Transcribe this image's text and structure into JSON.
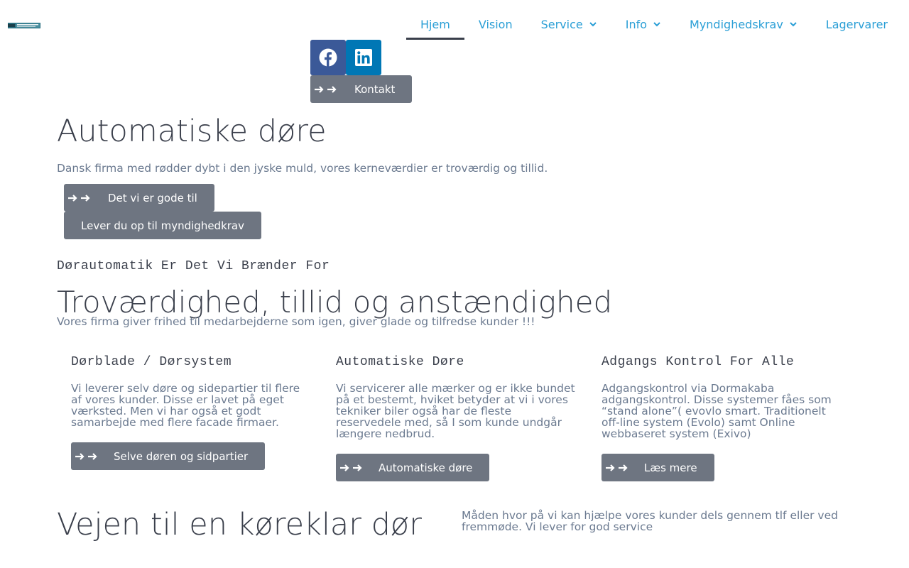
{
  "header": {
    "logo_alt": "TIC SERVICE",
    "nav": [
      {
        "label": "Hjem",
        "active": true,
        "dropdown": false
      },
      {
        "label": "Vision",
        "active": false,
        "dropdown": false
      },
      {
        "label": "Service",
        "active": false,
        "dropdown": true
      },
      {
        "label": "Info",
        "active": false,
        "dropdown": true
      },
      {
        "label": "Myndighedskrav",
        "active": false,
        "dropdown": true
      },
      {
        "label": "Lagervarer",
        "active": false,
        "dropdown": false
      }
    ]
  },
  "social": {
    "facebook_icon": "facebook-icon",
    "linkedin_icon": "linkedin-icon"
  },
  "contact_button": "Kontakt",
  "hero": {
    "title": "Automatiske døre",
    "text": "Dansk firma med rødder dybt i den jyske muld, vores kerneværdier er troværdig og tillid.",
    "button1": "Det vi er gode til",
    "button2": "Lever du op til myndighedkrav"
  },
  "section": {
    "kicker": "Dørautomatik Er Det Vi Brænder For",
    "title": "Troværdighed, tillid og anstændighed",
    "text": "Vores firma giver frihed til medarbejderne som igen, giver glade og tilfredse kunder !!!"
  },
  "columns": [
    {
      "title": "Dørblade / Dørsystem",
      "text": "Vi leverer selv døre og sidepartier til flere af vores kunder. Disse er lavet på eget værksted. Men vi har også et godt samarbejde med flere facade firmaer.",
      "button": "Selve døren og sidpartier"
    },
    {
      "title": "Automatiske Døre",
      "text": "Vi servicerer alle mærker og er ikke bundet på et bestemt, hviket betyder at vi i vores tekniker biler også har de fleste reservedele med, så I som kunde undgår længere nedbrud.",
      "button": "Automatiske døre"
    },
    {
      "title": "Adgangs Kontrol For Alle",
      "text": "Adgangskontrol via Dormakaba adgangskontrol. Disse systemer fåes som “stand alone”( evovlo smart. Traditionelt off-line system (Evolo) samt Online webbaseret system (Exivo)",
      "button": "Læs mere"
    }
  ],
  "bottom": {
    "title": "Vejen til en køreklar dør",
    "text": "Måden hvor på vi kan hjælpe vores kunder dels gennem tlf eller ved fremmøde. Vi lever for god service"
  }
}
